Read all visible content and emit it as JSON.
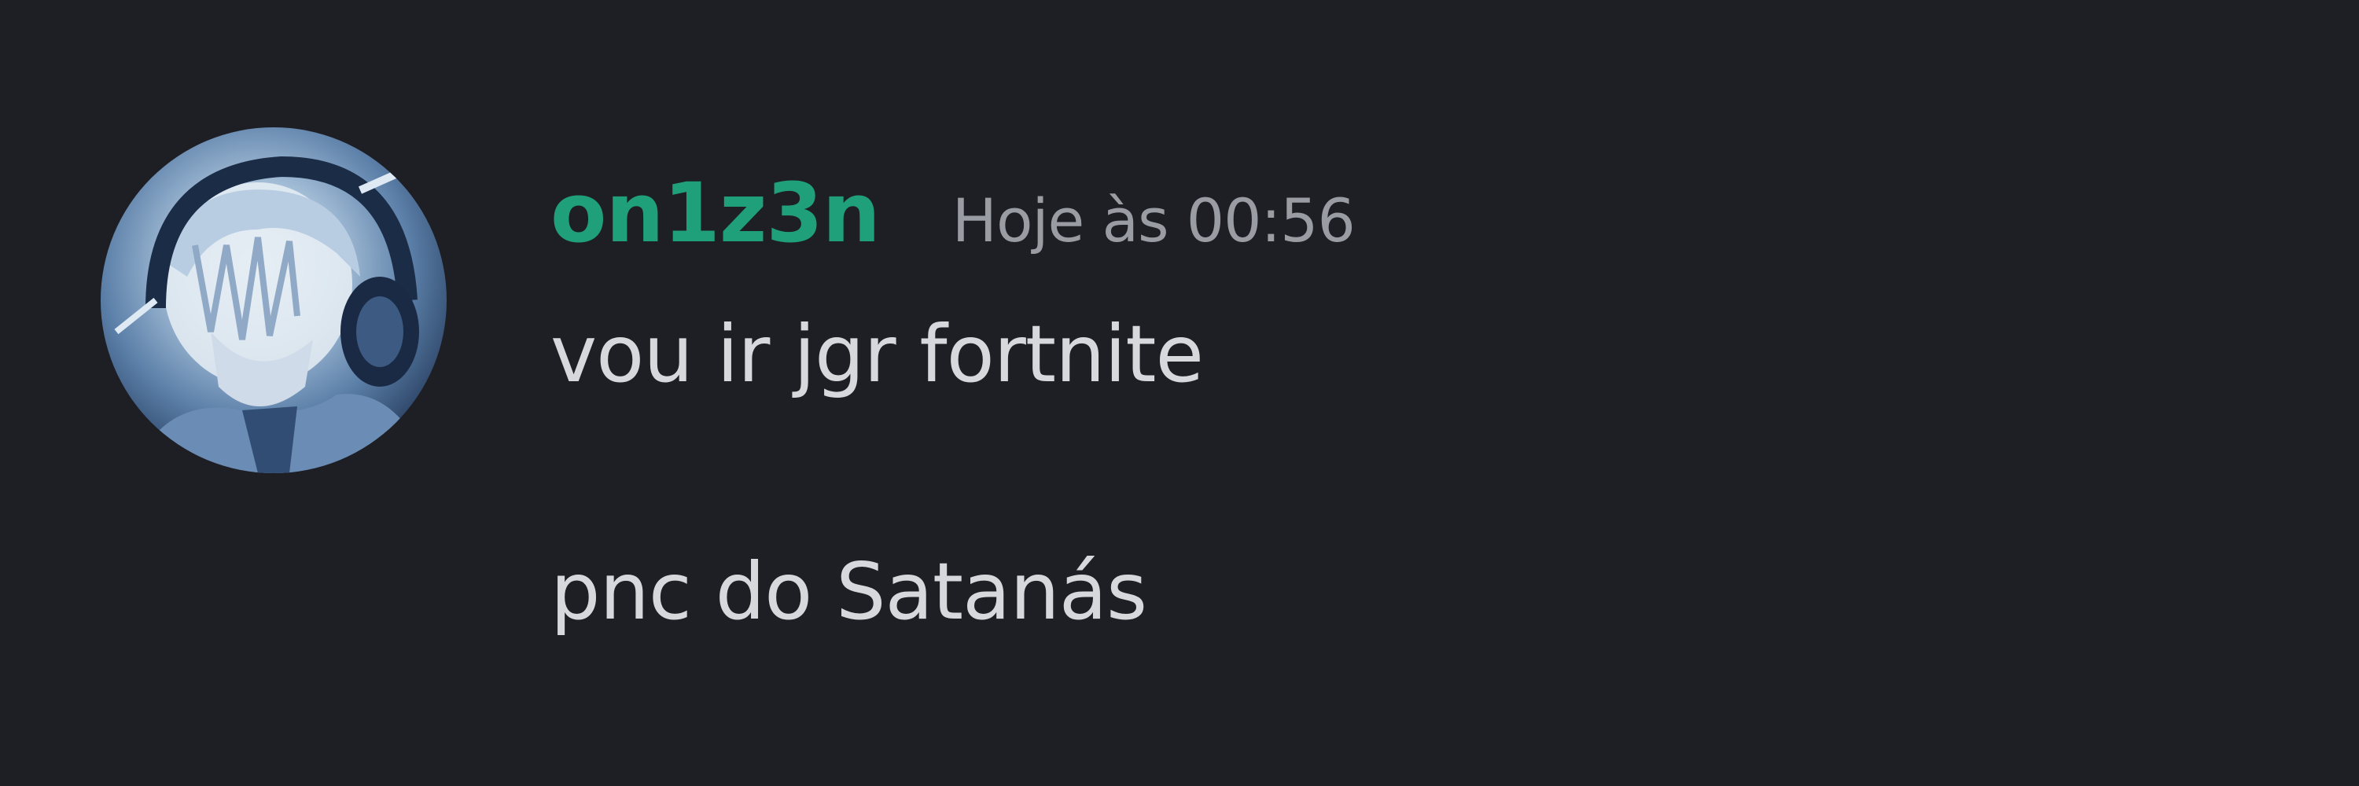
{
  "message": {
    "author": {
      "username": "on1z3n",
      "username_color": "#1f9f7a"
    },
    "timestamp": "Hoje às 00:56",
    "lines": [
      "vou ir jgr fortnite",
      "pnc do Satanás"
    ]
  }
}
